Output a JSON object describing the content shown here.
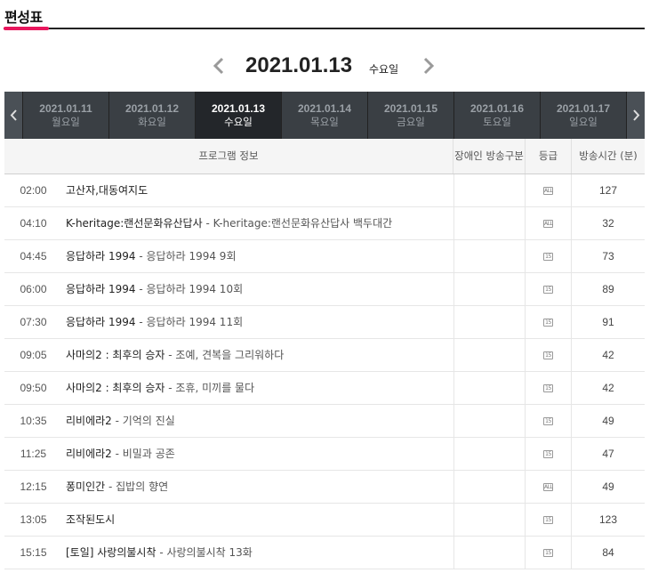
{
  "page": {
    "title": "편성표"
  },
  "date_header": {
    "date": "2021.01.13",
    "day_of_week": "수요일"
  },
  "week": [
    {
      "date": "2021.01.11",
      "dow": "월요일",
      "active": false
    },
    {
      "date": "2021.01.12",
      "dow": "화요일",
      "active": false
    },
    {
      "date": "2021.01.13",
      "dow": "수요일",
      "active": true
    },
    {
      "date": "2021.01.14",
      "dow": "목요일",
      "active": false
    },
    {
      "date": "2021.01.15",
      "dow": "금요일",
      "active": false
    },
    {
      "date": "2021.01.16",
      "dow": "토요일",
      "active": false
    },
    {
      "date": "2021.01.17",
      "dow": "일요일",
      "active": false
    }
  ],
  "table": {
    "headers": {
      "program": "프로그램 정보",
      "disability": "장애인 방송구분",
      "grade": "등급",
      "duration": "방송시간 (분)"
    },
    "rows": [
      {
        "time": "02:00",
        "title": "고산자,대동여지도",
        "subtitle": "",
        "grade": "ALL",
        "duration": "127"
      },
      {
        "time": "04:10",
        "title": "K-heritage:랜선문화유산답사",
        "subtitle": " - K-heritage:랜선문화유산답사 백두대간",
        "grade": "ALL",
        "duration": "32"
      },
      {
        "time": "04:45",
        "title": "응답하라 1994",
        "subtitle": " - 응답하라 1994 9회",
        "grade": "15",
        "duration": "73"
      },
      {
        "time": "06:00",
        "title": "응답하라 1994",
        "subtitle": " - 응답하라 1994 10회",
        "grade": "15",
        "duration": "89"
      },
      {
        "time": "07:30",
        "title": "응답하라 1994",
        "subtitle": " - 응답하라 1994 11회",
        "grade": "15",
        "duration": "91"
      },
      {
        "time": "09:05",
        "title": "사마의2 : 최후의 승자",
        "subtitle": " - 조예, 견복을 그리워하다",
        "grade": "15",
        "duration": "42"
      },
      {
        "time": "09:50",
        "title": "사마의2 : 최후의 승자",
        "subtitle": " - 조휴, 미끼를 물다",
        "grade": "15",
        "duration": "42"
      },
      {
        "time": "10:35",
        "title": "리비에라2",
        "subtitle": " - 기억의 진실",
        "grade": "15",
        "duration": "49"
      },
      {
        "time": "11:25",
        "title": "리비에라2",
        "subtitle": " - 비밀과 공존",
        "grade": "15",
        "duration": "47"
      },
      {
        "time": "12:15",
        "title": "퐁미인간",
        "subtitle": " - 집밥의 향연",
        "grade": "ALL",
        "duration": "49"
      },
      {
        "time": "13:05",
        "title": "조작된도시",
        "subtitle": "",
        "grade": "15",
        "duration": "123"
      },
      {
        "time": "15:15",
        "title": "[토일] 사랑의불시착",
        "subtitle": " - 사랑의불시착 13화",
        "grade": "15",
        "duration": "84"
      }
    ]
  },
  "colors": {
    "accent": "#e8175d",
    "tab_bar": "#3a3f44",
    "tab_active": "#23262a"
  },
  "icons": {
    "date_prev": "chevron-left-icon",
    "date_next": "chevron-right-icon",
    "week_prev": "chevron-left-icon",
    "week_next": "chevron-right-icon",
    "grade": "rating-badge-icon"
  }
}
